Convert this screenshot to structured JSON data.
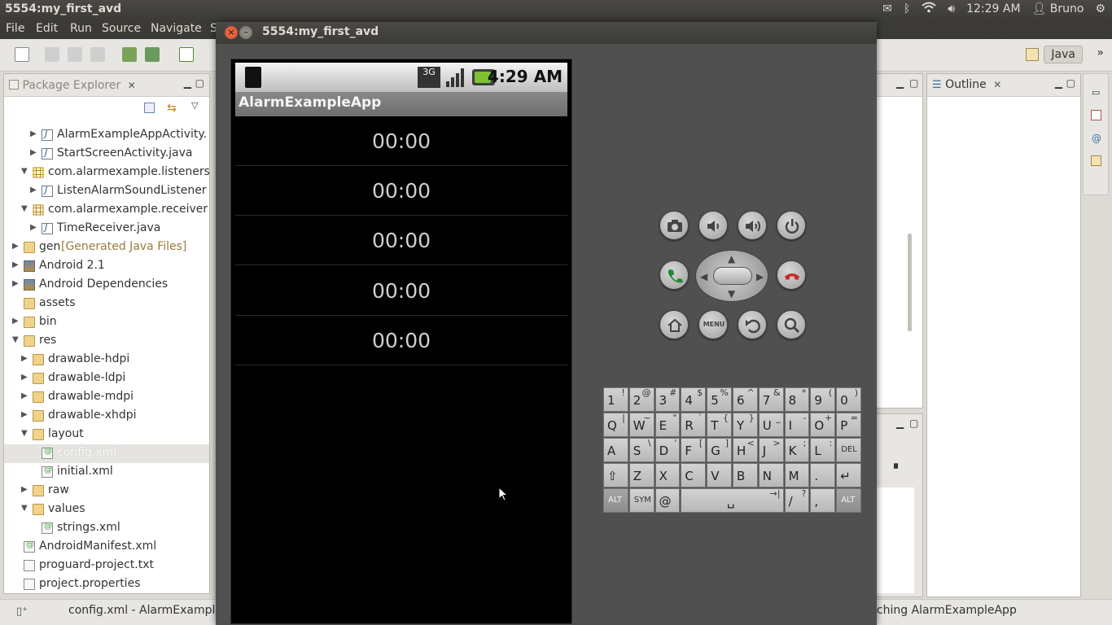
{
  "top_panel": {
    "title": "5554:my_first_avd",
    "time": "12:29 AM",
    "user": "Bruno"
  },
  "menubar": {
    "items": [
      "File",
      "Edit",
      "Run",
      "Source",
      "Navigate",
      "S"
    ]
  },
  "toolbar": {
    "perspective": "Java"
  },
  "package_explorer": {
    "title": "Package Explorer",
    "rows": [
      {
        "label": "AlarmExampleAppActivity.",
        "icon": "java-file-icon",
        "indent": 2,
        "arrow": "right"
      },
      {
        "label": "StartScreenActivity.java",
        "icon": "java-file-icon",
        "indent": 2,
        "arrow": "right"
      },
      {
        "label": "com.alarmexample.listeners",
        "icon": "package-icon",
        "indent": 1,
        "arrow": "down"
      },
      {
        "label": "ListenAlarmSoundListener",
        "icon": "java-file-icon",
        "indent": 2,
        "arrow": "right"
      },
      {
        "label": "com.alarmexample.receiver",
        "icon": "package-icon",
        "indent": 1,
        "arrow": "down"
      },
      {
        "label": "TimeReceiver.java",
        "icon": "java-file-icon",
        "indent": 2,
        "arrow": "right"
      },
      {
        "label": "gen",
        "tag": "[Generated Java Files]",
        "icon": "folder-icon",
        "indent": 0,
        "arrow": "right"
      },
      {
        "label": "Android 2.1",
        "icon": "library-icon",
        "indent": 0,
        "arrow": "right"
      },
      {
        "label": "Android Dependencies",
        "icon": "library-icon",
        "indent": 0,
        "arrow": "right"
      },
      {
        "label": "assets",
        "icon": "folder-icon",
        "indent": 0,
        "arrow": ""
      },
      {
        "label": "bin",
        "icon": "folder-icon",
        "indent": 0,
        "arrow": "right"
      },
      {
        "label": "res",
        "icon": "folder-icon",
        "indent": 0,
        "arrow": "down"
      },
      {
        "label": "drawable-hdpi",
        "icon": "folder-icon",
        "indent": 1,
        "arrow": "right"
      },
      {
        "label": "drawable-ldpi",
        "icon": "folder-icon",
        "indent": 1,
        "arrow": "right"
      },
      {
        "label": "drawable-mdpi",
        "icon": "folder-icon",
        "indent": 1,
        "arrow": "right"
      },
      {
        "label": "drawable-xhdpi",
        "icon": "folder-icon",
        "indent": 1,
        "arrow": "right"
      },
      {
        "label": "layout",
        "icon": "folder-icon",
        "indent": 1,
        "arrow": "down"
      },
      {
        "label": "config.xml",
        "icon": "xml-file-icon",
        "indent": 2,
        "arrow": "",
        "selected": true
      },
      {
        "label": "initial.xml",
        "icon": "xml-file-icon",
        "indent": 2,
        "arrow": ""
      },
      {
        "label": "raw",
        "icon": "folder-icon",
        "indent": 1,
        "arrow": "right"
      },
      {
        "label": "values",
        "icon": "folder-icon",
        "indent": 1,
        "arrow": "down"
      },
      {
        "label": "strings.xml",
        "icon": "xml-file-icon",
        "indent": 2,
        "arrow": ""
      },
      {
        "label": "AndroidManifest.xml",
        "icon": "xml-file-icon",
        "indent": 0,
        "arrow": ""
      },
      {
        "label": "proguard-project.txt",
        "icon": "text-file-icon",
        "indent": 0,
        "arrow": ""
      },
      {
        "label": "project.properties",
        "icon": "text-file-icon",
        "indent": 0,
        "arrow": ""
      }
    ]
  },
  "outline": {
    "title": "Outline"
  },
  "statusbar": {
    "left": "config.xml - AlarmExample",
    "right": "nching AlarmExampleApp"
  },
  "emulator": {
    "title": "5554:my_first_avd",
    "phone_time": "4:29 AM",
    "network": "3G",
    "app_title": "AlarmExampleApp",
    "alarms": [
      "00:00",
      "00:00",
      "00:00",
      "00:00",
      "00:00"
    ],
    "menu_label": "MENU"
  },
  "keyboard": {
    "rows": [
      [
        [
          "1",
          "!"
        ],
        [
          "2",
          "@"
        ],
        [
          "3",
          "#"
        ],
        [
          "4",
          "$"
        ],
        [
          "5",
          "%"
        ],
        [
          "6",
          "^"
        ],
        [
          "7",
          "&"
        ],
        [
          "8",
          "*"
        ],
        [
          "9",
          "("
        ],
        [
          "0",
          ")"
        ]
      ],
      [
        [
          "Q",
          "|"
        ],
        [
          "W",
          "~"
        ],
        [
          "E",
          "\""
        ],
        [
          "R",
          "`"
        ],
        [
          "T",
          "{"
        ],
        [
          "Y",
          "}"
        ],
        [
          "U",
          "_"
        ],
        [
          "I",
          "-"
        ],
        [
          "O",
          "+"
        ],
        [
          "P",
          "="
        ]
      ],
      [
        [
          "A",
          ""
        ],
        [
          "S",
          "\\"
        ],
        [
          "D",
          "'"
        ],
        [
          "F",
          "["
        ],
        [
          "G",
          "]"
        ],
        [
          "H",
          "<"
        ],
        [
          "J",
          ">"
        ],
        [
          "K",
          ";"
        ],
        [
          "L",
          ":"
        ],
        [
          "DEL",
          ""
        ]
      ],
      [
        [
          "⇧",
          ""
        ],
        [
          "Z",
          ""
        ],
        [
          "X",
          ""
        ],
        [
          "C",
          ""
        ],
        [
          "V",
          ""
        ],
        [
          "B",
          ""
        ],
        [
          "N",
          ""
        ],
        [
          "M",
          ""
        ],
        [
          ".",
          ""
        ],
        [
          "↵",
          ""
        ]
      ],
      [
        [
          "ALT",
          ""
        ],
        [
          "SYM",
          ""
        ],
        [
          "@",
          ""
        ],
        [
          "␣",
          "→|"
        ],
        [
          "/",
          "?"
        ],
        [
          ",",
          ""
        ],
        [
          "ALT",
          ""
        ]
      ]
    ]
  }
}
